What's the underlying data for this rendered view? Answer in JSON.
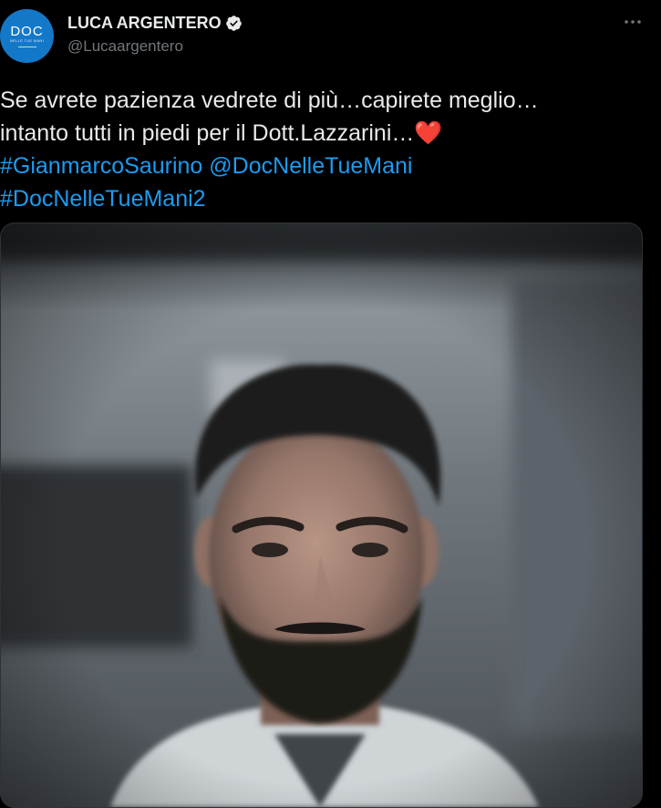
{
  "author": {
    "name": "LUCA ARGENTERO",
    "handle": "@Lucaargentero",
    "avatar": {
      "logo_text": "DOC",
      "logo_subtext": "NELLE TUE MANI",
      "color": "#1478c8"
    },
    "verified_icon": "verified-badge-icon"
  },
  "more_icon": "more-options-icon",
  "tweet": {
    "line1": "Se avrete pazienza vedrete di più…capirete meglio…",
    "line2_text": "intanto tutti in piedi per il Dott.Lazzarini…",
    "heart": "❤️",
    "hashtag1": "#GianmarcoSaurino",
    "mention": "@DocNelleTueMani",
    "hashtag2": "#DocNelleTueMani2"
  },
  "media": {
    "kind": "photo",
    "subject": "portrait"
  },
  "colors": {
    "background": "#000000",
    "text": "#e7e9ea",
    "secondary": "#71767b",
    "link": "#1d9bf0",
    "heart": "#e0245e"
  }
}
